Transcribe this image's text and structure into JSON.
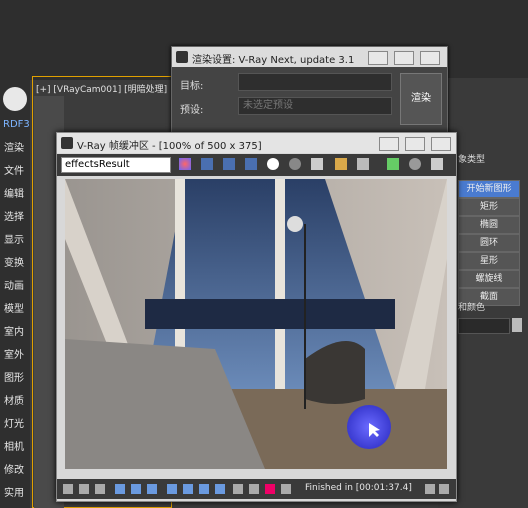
{
  "viewport": {
    "label": "[+] [VRayCam001] [明暗处理]"
  },
  "sidebar": {
    "brand": "RDF3",
    "items": [
      "渲染",
      "文件",
      "编辑",
      "选择",
      "显示",
      "变换",
      "动画",
      "模型",
      "室内",
      "室外",
      "图形",
      "材质",
      "灯光",
      "相机",
      "修改",
      "实用"
    ]
  },
  "render_setup": {
    "title": "渲染设置: V-Ray Next, update 3.1",
    "target_label": "目标:",
    "preset_label": "预设:",
    "preset_placeholder": "未选定预设",
    "render_button": "渲染"
  },
  "frame_buffer": {
    "title": "V-Ray 帧缓冲区 - [100% of 500 x 375]",
    "channel": "effectsResult",
    "status": "Finished in [00:01:37.4]"
  },
  "right_panel": {
    "object_type_label": "象类型",
    "items": [
      "开始新图形",
      "矩形",
      "椭圆",
      "圆环",
      "星形",
      "螺旋线",
      "截面"
    ],
    "name_color_label": "和颜色"
  }
}
